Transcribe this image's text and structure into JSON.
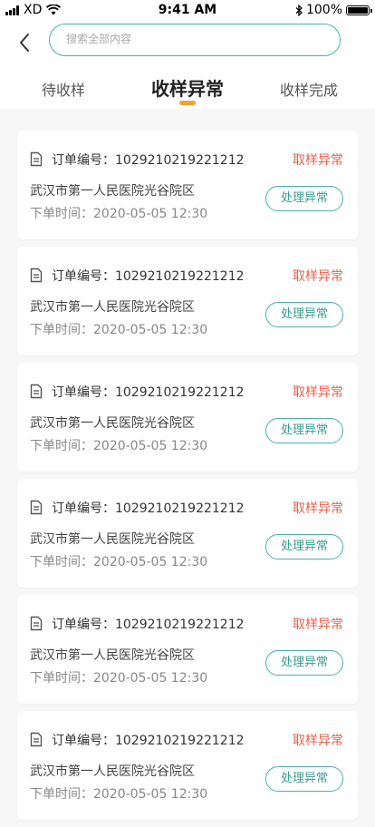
{
  "status_bar": {
    "carrier": "XD",
    "time": "9:41 AM",
    "battery_label": "100%",
    "battery_level": 1.0,
    "icons": [
      "signal-icon",
      "wifi-icon",
      "bluetooth-icon",
      "battery-icon"
    ]
  },
  "search": {
    "placeholder": "搜索全部内容"
  },
  "tabs": [
    {
      "label": "待收样",
      "active": false
    },
    {
      "label": "收样异常",
      "active": true
    },
    {
      "label": "收样完成",
      "active": false
    }
  ],
  "colors": {
    "accent": "#49b2a8",
    "tab_indicator": "#f2a033",
    "status_red": "#e4634d"
  },
  "orders": [
    {
      "order_label": "订单编号：1029210219221212",
      "status": "取样异常",
      "hospital": "武汉市第一人民医院光谷院区",
      "time": "下单时间：2020-05-05 12:30",
      "action": "处理异常"
    },
    {
      "order_label": "订单编号：1029210219221212",
      "status": "取样异常",
      "hospital": "武汉市第一人民医院光谷院区",
      "time": "下单时间：2020-05-05 12:30",
      "action": "处理异常"
    },
    {
      "order_label": "订单编号：1029210219221212",
      "status": "取样异常",
      "hospital": "武汉市第一人民医院光谷院区",
      "time": "下单时间：2020-05-05 12:30",
      "action": "处理异常"
    },
    {
      "order_label": "订单编号：1029210219221212",
      "status": "取样异常",
      "hospital": "武汉市第一人民医院光谷院区",
      "time": "下单时间：2020-05-05 12:30",
      "action": "处理异常"
    },
    {
      "order_label": "订单编号：1029210219221212",
      "status": "取样异常",
      "hospital": "武汉市第一人民医院光谷院区",
      "time": "下单时间：2020-05-05 12:30",
      "action": "处理异常"
    },
    {
      "order_label": "订单编号：1029210219221212",
      "status": "取样异常",
      "hospital": "武汉市第一人民医院光谷院区",
      "time": "下单时间：2020-05-05 12:30",
      "action": "处理异常"
    }
  ]
}
